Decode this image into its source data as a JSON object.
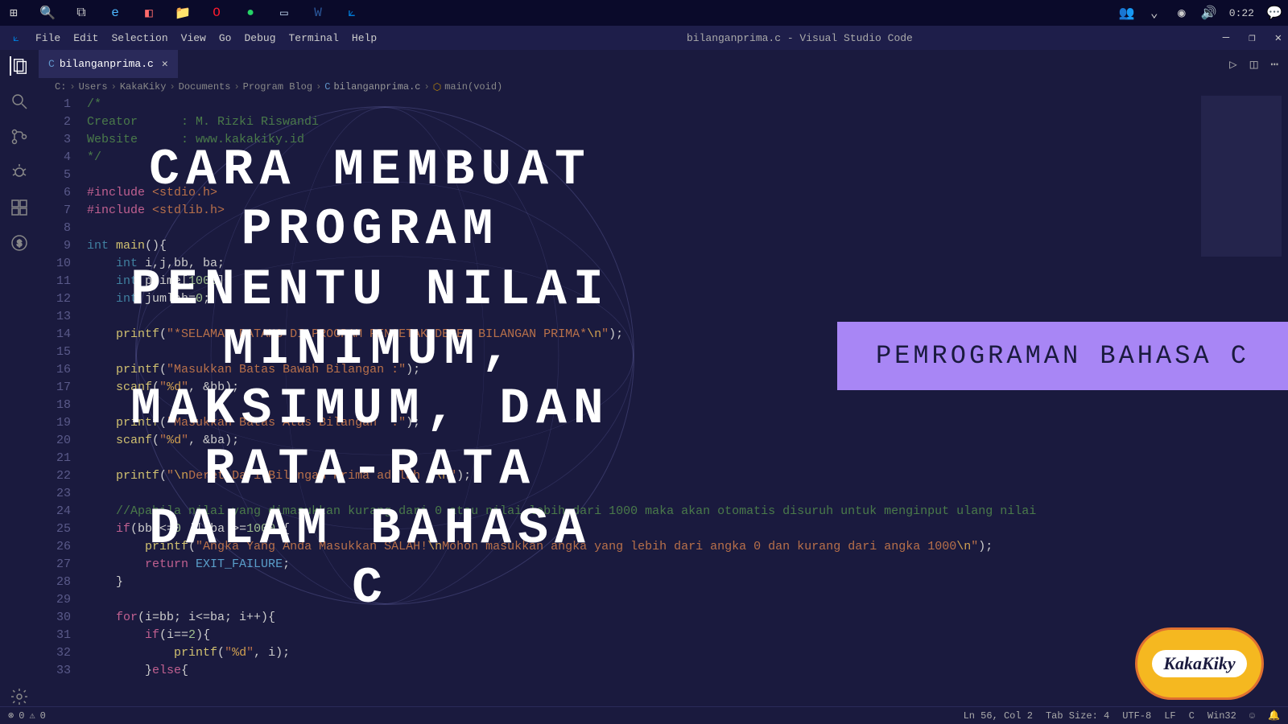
{
  "taskbar": {
    "clock": "0:22"
  },
  "titlebar": {
    "menus": [
      "File",
      "Edit",
      "Selection",
      "View",
      "Go",
      "Debug",
      "Terminal",
      "Help"
    ],
    "title": "bilanganprima.c - Visual Studio Code"
  },
  "tab": {
    "icon_label": "C",
    "filename": "bilanganprima.c"
  },
  "breadcrumb": {
    "parts": [
      "C:",
      "Users",
      "KakaKiky",
      "Documents",
      "Program Blog"
    ],
    "file_icon": "C",
    "file": "bilanganprima.c",
    "fn": "main(void)"
  },
  "code_lines": [
    {
      "n": 1,
      "html": "<span class='tok-comment'>/*</span>"
    },
    {
      "n": 2,
      "html": "<span class='tok-comment'>Creator      : M. Rizki Riswandi</span>"
    },
    {
      "n": 3,
      "html": "<span class='tok-comment'>Website      : www.kakakiky.id</span>"
    },
    {
      "n": 4,
      "html": "<span class='tok-comment'>*/</span>"
    },
    {
      "n": 5,
      "html": ""
    },
    {
      "n": 6,
      "html": "<span class='tok-include'>#include</span> <span class='tok-string'>&lt;stdio.h&gt;</span>"
    },
    {
      "n": 7,
      "html": "<span class='tok-include'>#include</span> <span class='tok-string'>&lt;stdlib.h&gt;</span>"
    },
    {
      "n": 8,
      "html": ""
    },
    {
      "n": 9,
      "html": "<span class='tok-type'>int</span> <span class='tok-func'>main</span>(){ "
    },
    {
      "n": 10,
      "html": "    <span class='tok-type'>int</span> i,j,bb, ba;"
    },
    {
      "n": 11,
      "html": "    <span class='tok-type'>int</span> prime[<span class='tok-num'>1000</span>];"
    },
    {
      "n": 12,
      "html": "    <span class='tok-type'>int</span> jumlah=<span class='tok-num'>0</span>;"
    },
    {
      "n": 13,
      "html": ""
    },
    {
      "n": 14,
      "html": "    <span class='tok-func'>printf</span>(<span class='tok-string'>\"*SELAMAT DATANG DI PROGRAM PENCETAK DERET BILANGAN PRIMA*</span><span class='tok-escape'>\\n</span><span class='tok-string'>\"</span>);"
    },
    {
      "n": 15,
      "html": ""
    },
    {
      "n": 16,
      "html": "    <span class='tok-func'>printf</span>(<span class='tok-string'>\"Masukkan Batas Bawah Bilangan :\"</span>);"
    },
    {
      "n": 17,
      "html": "    <span class='tok-func'>scanf</span>(<span class='tok-string'>\"</span><span class='tok-escape'>%d</span><span class='tok-string'>\"</span>, &amp;bb);"
    },
    {
      "n": 18,
      "html": ""
    },
    {
      "n": 19,
      "html": "    <span class='tok-func'>printf</span>(<span class='tok-string'>\"Masukkan Batas Atas Bilangan  :\"</span>);"
    },
    {
      "n": 20,
      "html": "    <span class='tok-func'>scanf</span>(<span class='tok-string'>\"</span><span class='tok-escape'>%d</span><span class='tok-string'>\"</span>, &amp;ba);"
    },
    {
      "n": 21,
      "html": ""
    },
    {
      "n": 22,
      "html": "    <span class='tok-func'>printf</span>(<span class='tok-string'>\"</span><span class='tok-escape'>\\n</span><span class='tok-string'>Deret Dari Bilangan Prima adalah :</span><span class='tok-escape'>\\n</span><span class='tok-string'>\"</span>);"
    },
    {
      "n": 23,
      "html": ""
    },
    {
      "n": 24,
      "html": "    <span class='tok-comment'>//Apabila nilai yang dimasukkan kurang dari 0 atau nilai lebih dari 1000 maka akan otomatis disuruh untuk menginput ulang nilai</span>"
    },
    {
      "n": 25,
      "html": "    <span class='tok-keyword'>if</span>(bb &lt;=<span class='tok-num'>0</span> || ba &gt;=<span class='tok-num'>1000</span>){"
    },
    {
      "n": 26,
      "html": "        <span class='tok-func'>printf</span>(<span class='tok-string'>\"Angka Yang Anda Masukkan SALAH!</span><span class='tok-escape'>\\n</span><span class='tok-string'>Mohon masukkan angka yang lebih dari angka 0 dan kurang dari angka 1000</span><span class='tok-escape'>\\n</span><span class='tok-string'>\"</span>);"
    },
    {
      "n": 27,
      "html": "        <span class='tok-keyword'>return</span> <span class='tok-macro'>EXIT_FAILURE</span>;"
    },
    {
      "n": 28,
      "html": "    }"
    },
    {
      "n": 29,
      "html": ""
    },
    {
      "n": 30,
      "html": "    <span class='tok-keyword'>for</span>(i=bb; i&lt;=ba; i++){"
    },
    {
      "n": 31,
      "html": "        <span class='tok-keyword'>if</span>(i==<span class='tok-num'>2</span>){"
    },
    {
      "n": 32,
      "html": "            <span class='tok-func'>printf</span>(<span class='tok-string'>\"</span><span class='tok-escape'>%d</span><span class='tok-string'>\"</span>, i);"
    },
    {
      "n": 33,
      "html": "        }<span class='tok-keyword'>else</span>{"
    }
  ],
  "overlay": {
    "title": "CARA MEMBUAT PROGRAM PENENTU NILAI MINIMUM, MAKSIMUM, DAN RATA-RATA DALAM BAHASA C",
    "badge": "PEMROGRAMAN BAHASA C"
  },
  "logo": {
    "text": "KakaKiky"
  },
  "statusbar": {
    "errors": "0",
    "warnings": "0",
    "position": "Ln 56, Col 2",
    "tabsize": "Tab Size: 4",
    "encoding": "UTF-8",
    "eol": "LF",
    "language": "C",
    "os": "Win32",
    "bell": "🔔"
  }
}
